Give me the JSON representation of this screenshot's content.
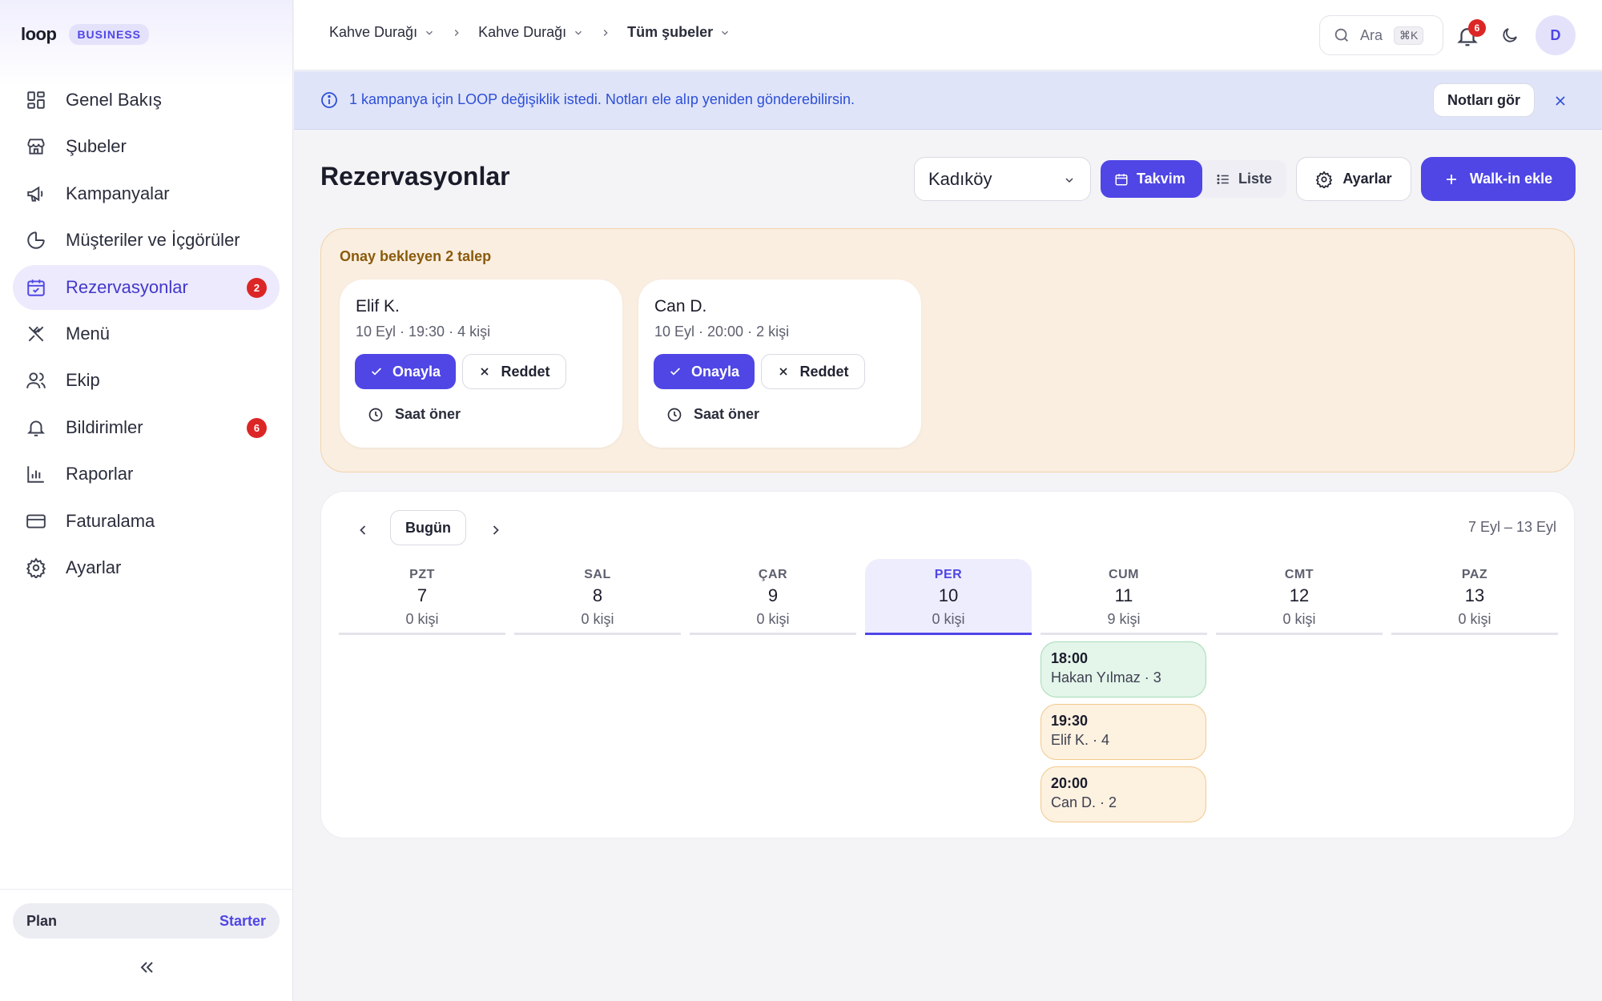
{
  "brand": {
    "logo": "loop",
    "badge": "BUSINESS"
  },
  "sidebar": {
    "items": [
      {
        "label": "Genel Bakış",
        "icon": "dashboard-icon"
      },
      {
        "label": "Şubeler",
        "icon": "store-icon"
      },
      {
        "label": "Kampanyalar",
        "icon": "megaphone-icon"
      },
      {
        "label": "Müşteriler ve İçgörüler",
        "icon": "pie-chart-icon"
      },
      {
        "label": "Rezervasyonlar",
        "icon": "calendar-check-icon",
        "badge": "2",
        "active": true
      },
      {
        "label": "Menü",
        "icon": "utensils-icon"
      },
      {
        "label": "Ekip",
        "icon": "users-icon"
      },
      {
        "label": "Bildirimler",
        "icon": "bell-icon",
        "badge": "6"
      },
      {
        "label": "Raporlar",
        "icon": "bar-chart-icon"
      },
      {
        "label": "Faturalama",
        "icon": "credit-card-icon"
      },
      {
        "label": "Ayarlar",
        "icon": "gear-icon"
      }
    ],
    "plan": {
      "label": "Plan",
      "value": "Starter"
    }
  },
  "topbar": {
    "breadcrumbs": [
      "Kahve Durağı",
      "Kahve Durağı",
      "Tüm şubeler"
    ],
    "search_placeholder": "Ara",
    "search_shortcut": "⌘K",
    "notification_count": "6",
    "avatar_initial": "D"
  },
  "banner": {
    "text": "1 kampanya için LOOP değişiklik istedi. Notları ele alıp yeniden gönderebilirsin.",
    "button": "Notları gör"
  },
  "page": {
    "title": "Rezervasyonlar",
    "branch": "Kadıköy",
    "view_calendar": "Takvim",
    "view_list": "Liste",
    "settings": "Ayarlar",
    "walkin": "Walk-in ekle"
  },
  "pending": {
    "title": "Onay bekleyen 2 talep",
    "approve": "Onayla",
    "reject": "Reddet",
    "suggest": "Saat öner",
    "requests": [
      {
        "name": "Elif K.",
        "meta": "10 Eyl · 19:30 · 4 kişi"
      },
      {
        "name": "Can D.",
        "meta": "10 Eyl · 20:00 · 2 kişi"
      }
    ]
  },
  "calendar": {
    "today_label": "Bugün",
    "range": "7 Eyl – 13 Eyl",
    "days": [
      {
        "name": "PZT",
        "num": "7",
        "count": "0 kişi"
      },
      {
        "name": "SAL",
        "num": "8",
        "count": "0 kişi"
      },
      {
        "name": "ÇAR",
        "num": "9",
        "count": "0 kişi"
      },
      {
        "name": "PER",
        "num": "10",
        "count": "0 kişi",
        "today": true
      },
      {
        "name": "CUM",
        "num": "11",
        "count": "9 kişi"
      },
      {
        "name": "CMT",
        "num": "12",
        "count": "0 kişi"
      },
      {
        "name": "PAZ",
        "num": "13",
        "count": "0 kişi"
      }
    ],
    "events": [
      {
        "time": "18:00",
        "desc": "Hakan Yılmaz · 3",
        "status": "confirmed",
        "day": "CUM"
      },
      {
        "time": "19:30",
        "desc": "Elif K. · 4",
        "status": "pending",
        "day": "CUM"
      },
      {
        "time": "20:00",
        "desc": "Can D. · 2",
        "status": "pending",
        "day": "CUM"
      }
    ]
  },
  "colors": {
    "accent": "#4f46e5",
    "danger": "#dc2626",
    "banner": "#2c4fd8",
    "pending_bg": "#faeee0"
  }
}
